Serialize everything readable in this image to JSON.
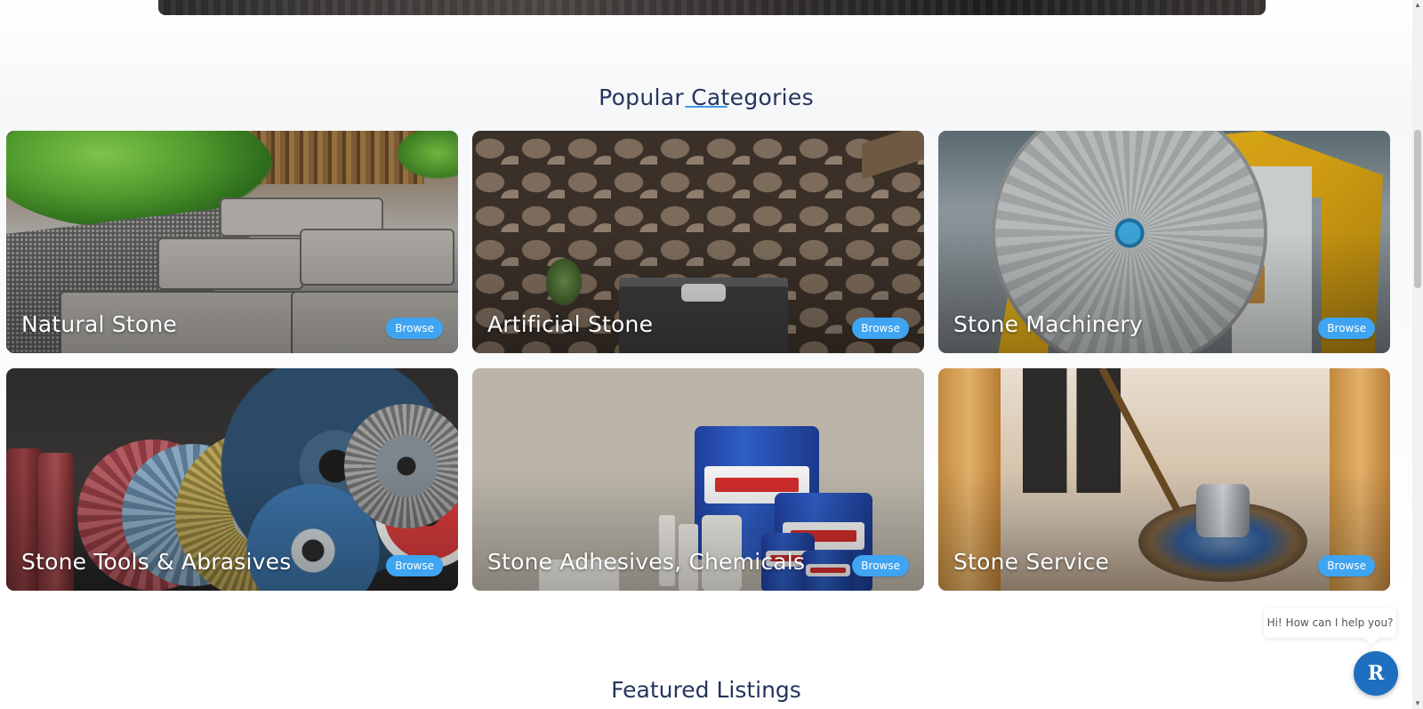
{
  "sections": {
    "popular": {
      "title": "Popular Categories"
    },
    "featured": {
      "title": "Featured Listings"
    }
  },
  "categories": [
    {
      "name": "Natural Stone",
      "browse_label": "Browse",
      "image": "natural-stone-paving"
    },
    {
      "name": "Artificial Stone",
      "browse_label": "Browse",
      "image": "stone-wall-bedroom"
    },
    {
      "name": "Stone Machinery",
      "browse_label": "Browse",
      "image": "stone-cutting-saw"
    },
    {
      "name": "Stone Tools & Abrasives",
      "browse_label": "Browse",
      "image": "abrasive-discs"
    },
    {
      "name": "Stone Adhesives, Chemicals",
      "browse_label": "Browse",
      "image": "tenax-adhesive-cans"
    },
    {
      "name": "Stone Service",
      "browse_label": "Browse",
      "image": "floor-polishing-machine"
    }
  ],
  "chat": {
    "greeting": "Hi! How can I help you?",
    "launcher_letter": "R"
  },
  "colors": {
    "heading": "#24345c",
    "accent": "#3fa4f1",
    "chat_button": "#1e6fbf"
  }
}
